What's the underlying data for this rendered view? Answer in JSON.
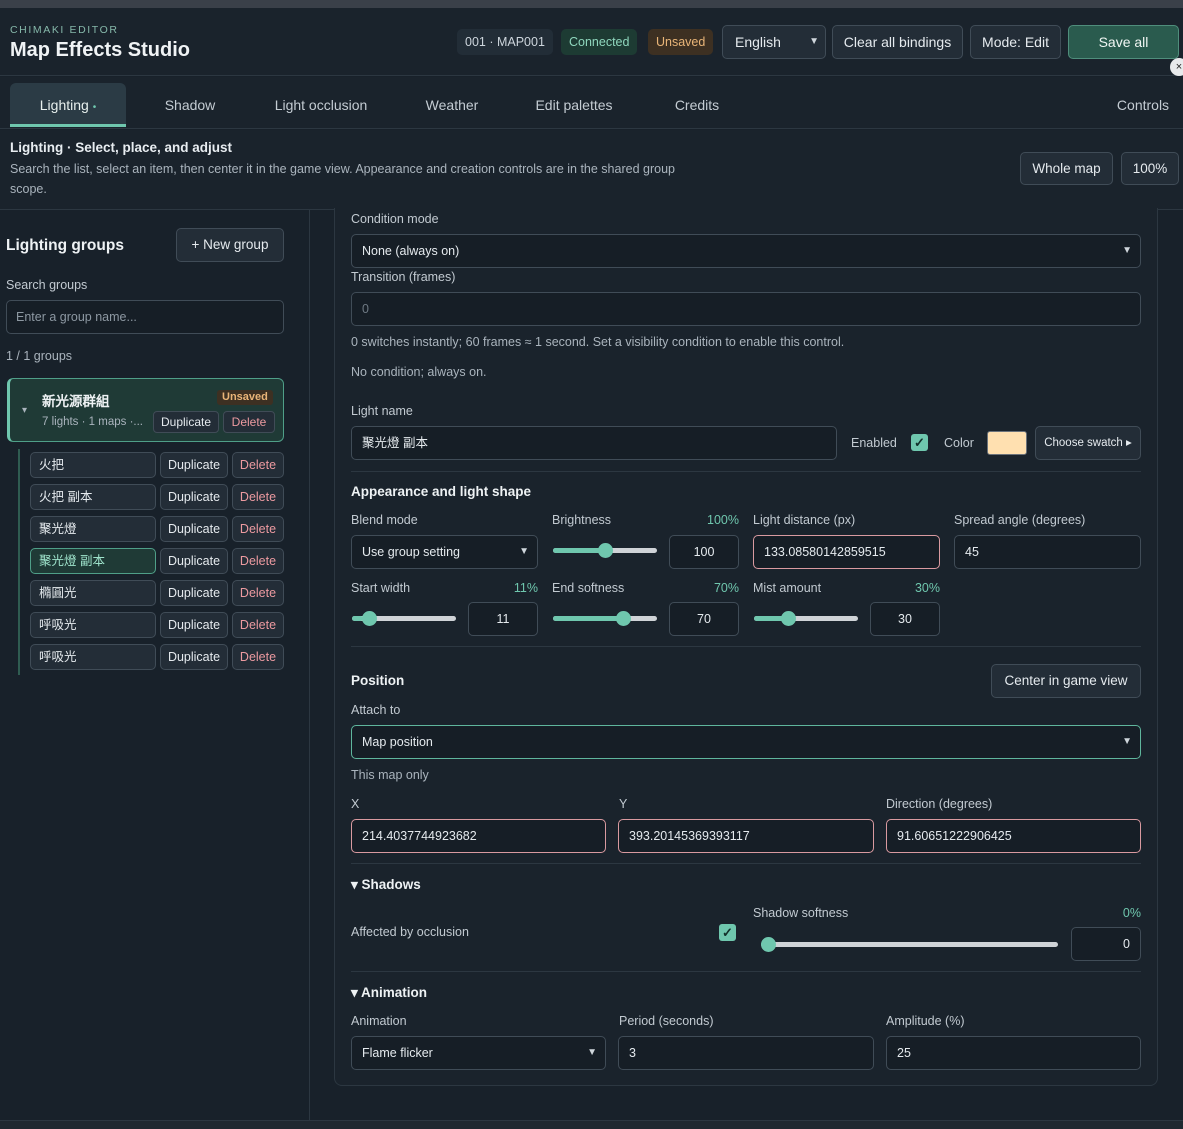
{
  "header": {
    "brand_small": "CHIMAKI EDITOR",
    "title": "Map Effects Studio",
    "map_chip": "001 · MAP001",
    "connection": "Connected",
    "save_state": "Unsaved",
    "language": "English",
    "clear_bindings": "Clear all bindings",
    "mode": "Mode: Edit",
    "save_all": "Save all",
    "close": "×"
  },
  "tabs": [
    {
      "label": "Lighting",
      "dot": "•",
      "active": true
    },
    {
      "label": "Shadow"
    },
    {
      "label": "Light occlusion"
    },
    {
      "label": "Weather"
    },
    {
      "label": "Edit palettes"
    },
    {
      "label": "Credits"
    },
    {
      "label": "Controls"
    }
  ],
  "info": {
    "title": "Lighting · Select, place, and adjust",
    "description": "Search the list, select an item, then center it in the game view. Appearance and creation controls are in the shared group scope.",
    "whole_map": "Whole map",
    "zoom": "100%"
  },
  "sidebar": {
    "title": "Lighting groups",
    "new_group": "+ New group",
    "search_label": "Search groups",
    "search_placeholder": "Enter a group name...",
    "count": "1 / 1 groups",
    "group": {
      "arrow": "▾",
      "name": "新光源群組",
      "badge": "Unsaved",
      "meta": "7 lights · 1 maps ·...",
      "duplicate": "Duplicate",
      "delete": "Delete"
    },
    "lights": [
      {
        "name": "火把",
        "duplicate": "Duplicate",
        "delete": "Delete"
      },
      {
        "name": "火把 副本",
        "duplicate": "Duplicate",
        "delete": "Delete"
      },
      {
        "name": "聚光燈",
        "duplicate": "Duplicate",
        "delete": "Delete"
      },
      {
        "name": "聚光燈 副本",
        "duplicate": "Duplicate",
        "delete": "Delete",
        "selected": true
      },
      {
        "name": "橢圓光",
        "duplicate": "Duplicate",
        "delete": "Delete"
      },
      {
        "name": "呼吸光",
        "duplicate": "Duplicate",
        "delete": "Delete"
      },
      {
        "name": "呼吸光",
        "duplicate": "Duplicate",
        "delete": "Delete"
      }
    ]
  },
  "panel": {
    "condition_mode_label": "Condition mode",
    "condition_mode": "None (always on)",
    "transition_label": "Transition (frames)",
    "transition_value": "0",
    "transition_help": "0 switches instantly; 60 frames ≈ 1 second. Set a visibility condition to enable this control.",
    "condition_note": "No condition; always on.",
    "light_name_label": "Light name",
    "light_name": "聚光燈 副本",
    "enabled_label": "Enabled",
    "color_label": "Color",
    "color_value": "#ffe0b0",
    "choose_swatch": "Choose swatch ▸",
    "appearance_title": "Appearance and light shape",
    "blend_mode_label": "Blend mode",
    "blend_mode": "Use group setting",
    "brightness_label": "Brightness",
    "brightness_pct": "100%",
    "brightness_value": "100",
    "brightness_level": 0.5,
    "light_distance_label": "Light distance (px)",
    "light_distance": "133.08580142859515",
    "spread_label": "Spread angle (degrees)",
    "spread": "45",
    "start_width_label": "Start width",
    "start_width_pct": "11%",
    "start_width_value": "11",
    "start_width_level": 0.11,
    "end_softness_label": "End softness",
    "end_softness_pct": "70%",
    "end_softness_value": "70",
    "end_softness_level": 0.7,
    "mist_label": "Mist amount",
    "mist_pct": "30%",
    "mist_value": "30",
    "mist_level": 0.3,
    "position_title": "Position",
    "center_btn": "Center in game view",
    "attach_label": "Attach to",
    "attach_value": "Map position",
    "attach_help": "This map only",
    "x_label": "X",
    "x_value": "214.4037744923682",
    "y_label": "Y",
    "y_value": "393.20145369393117",
    "dir_label": "Direction (degrees)",
    "dir_value": "91.60651222906425",
    "shadows_title": "▾ Shadows",
    "occlusion_label": "Affected by occlusion",
    "shadow_softness_label": "Shadow softness",
    "shadow_softness_pct": "0%",
    "shadow_softness_value": "0",
    "shadow_softness_level": 0.0,
    "animation_title": "▾ Animation",
    "animation_label": "Animation",
    "animation_value": "Flame flicker",
    "period_label": "Period (seconds)",
    "period_value": "3",
    "amplitude_label": "Amplitude (%)",
    "amplitude_value": "25",
    "check": "✓",
    "chevron": "⌄"
  }
}
